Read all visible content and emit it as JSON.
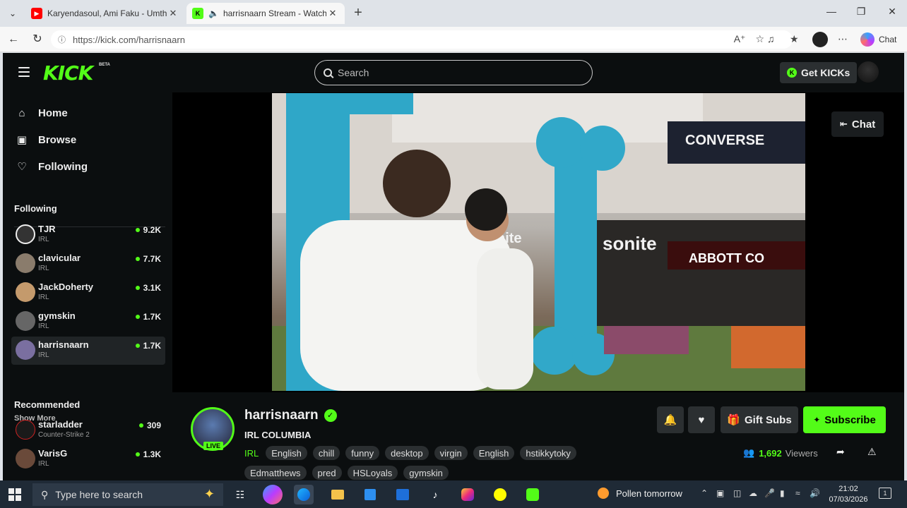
{
  "browser": {
    "tabs": [
      {
        "title": "Karyendasoul, Ami Faku - Umthan",
        "active": false
      },
      {
        "title": "harrisnaarn Stream - Watch Li",
        "active": true
      }
    ],
    "url": "https://kick.com/harrisnaarn",
    "chat_label": "Chat"
  },
  "kick": {
    "logo": "KICK",
    "beta": "BETA",
    "search_placeholder": "Search",
    "get_kicks": "Get KICKs",
    "chat_button": "Chat"
  },
  "sidebar": {
    "nav": [
      {
        "label": "Home",
        "icon": "home-icon"
      },
      {
        "label": "Browse",
        "icon": "browse-icon"
      },
      {
        "label": "Following",
        "icon": "heart-icon"
      }
    ],
    "following_title": "Following",
    "following": [
      {
        "name": "TJR",
        "category": "IRL",
        "viewers": "9.2K",
        "color": "#444"
      },
      {
        "name": "clavicular",
        "category": "IRL",
        "viewers": "7.7K",
        "color": "#8a7c6c"
      },
      {
        "name": "JackDoherty",
        "category": "IRL",
        "viewers": "3.1K",
        "color": "#c49a6c"
      },
      {
        "name": "gymskin",
        "category": "IRL",
        "viewers": "1.7K",
        "color": "#666"
      },
      {
        "name": "harrisnaarn",
        "category": "IRL",
        "viewers": "1.7K",
        "color": "#7a6fa0"
      }
    ],
    "show_more": "Show More",
    "recommended_title": "Recommended",
    "recommended": [
      {
        "name": "starladder",
        "category": "Counter-Strike 2",
        "viewers": "309",
        "color": "#c22"
      },
      {
        "name": "VarisG",
        "category": "IRL",
        "viewers": "1.3K",
        "color": "#6a4a3a"
      }
    ]
  },
  "stream": {
    "streamer": "harrisnaarn",
    "live": "LIVE",
    "title": "IRL COLUMBIA",
    "category": "IRL",
    "tags": [
      "English",
      "chill",
      "funny",
      "desktop",
      "virgin",
      "English",
      "hstikkytoky"
    ],
    "tags2": [
      "Edmatthews",
      "pred",
      "HSLoyals",
      "gymskin"
    ],
    "gift_subs": "Gift Subs",
    "subscribe": "Subscribe",
    "viewer_count": "1,692",
    "viewers_label": "Viewers",
    "video_signs": {
      "converse": "CONVERSE",
      "samsonite": "sonite",
      "store": "ABBOTT CO",
      "nite": "nite"
    }
  },
  "taskbar": {
    "search_placeholder": "Type here to search",
    "weather": "Pollen tomorrow",
    "time": "21:02",
    "date": "07/03/2026",
    "notifications": "1"
  }
}
